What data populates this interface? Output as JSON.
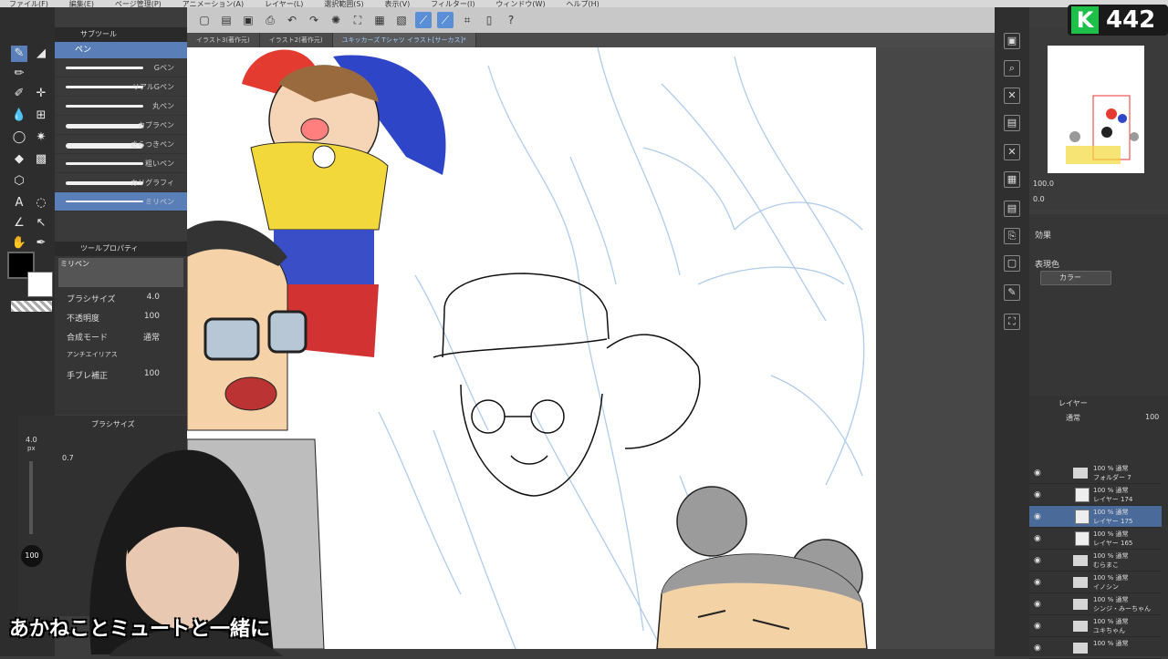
{
  "menubar": {
    "items": [
      "ファイル(F)",
      "編集(E)",
      "ページ管理(P)",
      "アニメーション(A)",
      "レイヤー(L)",
      "選択範囲(S)",
      "表示(V)",
      "フィルター(I)",
      "ウィンドウ(W)",
      "ヘルプ(H)"
    ]
  },
  "tabs": [
    {
      "label": "イラスト3(著作元)",
      "active": false
    },
    {
      "label": "イラスト2(著作元)",
      "active": false
    },
    {
      "label": "ユキッカーズ Tシャツ イラスト[サーカス]*",
      "active": true
    }
  ],
  "subtool": {
    "header": "サブツール",
    "group": "ペン",
    "pens": [
      {
        "label": "Gペン",
        "selected": false
      },
      {
        "label": "リアルGペン",
        "selected": false
      },
      {
        "label": "丸ペン",
        "selected": false
      },
      {
        "label": "カブラペン",
        "selected": false
      },
      {
        "label": "さらつきペン",
        "selected": false
      },
      {
        "label": "粗いペン",
        "selected": false
      },
      {
        "label": "カリグラフィ",
        "selected": false
      },
      {
        "label": "ミリペン",
        "selected": true
      }
    ]
  },
  "toolprop": {
    "header": "ツールプロパティ",
    "name": "ミリペン",
    "brush_size_label": "ブラシサイズ",
    "brush_size": "4.0",
    "opacity_label": "不透明度",
    "opacity": "100",
    "blend_label": "合成モード",
    "blend": "通常",
    "aa_label": "アンチエイリアス",
    "stab_label": "手ブレ補正",
    "stab": "100"
  },
  "brushsize_panel": {
    "header": "ブラシサイズ",
    "value": "4.0",
    "unit": "px",
    "v1": "0.7",
    "opacity_pct": "100"
  },
  "nav": {
    "zoom": "100.0",
    "angle": "0.0"
  },
  "effects": {
    "label": "効果",
    "color_label": "表現色",
    "color_value": "カラー"
  },
  "layers": {
    "header": "レイヤー",
    "blend": "通常",
    "opacity": "100",
    "rows": [
      {
        "line1": "100 % 通常",
        "line2": "フォルダー 7",
        "type": "folder",
        "selected": false
      },
      {
        "line1": "100 % 通常",
        "line2": "レイヤー 174",
        "type": "layer",
        "selected": false
      },
      {
        "line1": "100 % 通常",
        "line2": "レイヤー 175",
        "type": "layer",
        "selected": true
      },
      {
        "line1": "100 % 通常",
        "line2": "レイヤー 165",
        "type": "layer",
        "selected": false
      },
      {
        "line1": "100 % 通常",
        "line2": "むらまこ",
        "type": "folder",
        "selected": false
      },
      {
        "line1": "100 % 通常",
        "line2": "イノシン",
        "type": "folder",
        "selected": false
      },
      {
        "line1": "100 % 通常",
        "line2": "シンジ・みーちゃん",
        "type": "folder",
        "selected": false
      },
      {
        "line1": "100 % 通常",
        "line2": "ユキちゃん",
        "type": "folder",
        "selected": false
      },
      {
        "line1": "100 % 通常",
        "line2": "",
        "type": "folder",
        "selected": false
      }
    ]
  },
  "logo": {
    "letter": "K",
    "number": "442"
  },
  "caption": "あかねことミュートと一緒に"
}
